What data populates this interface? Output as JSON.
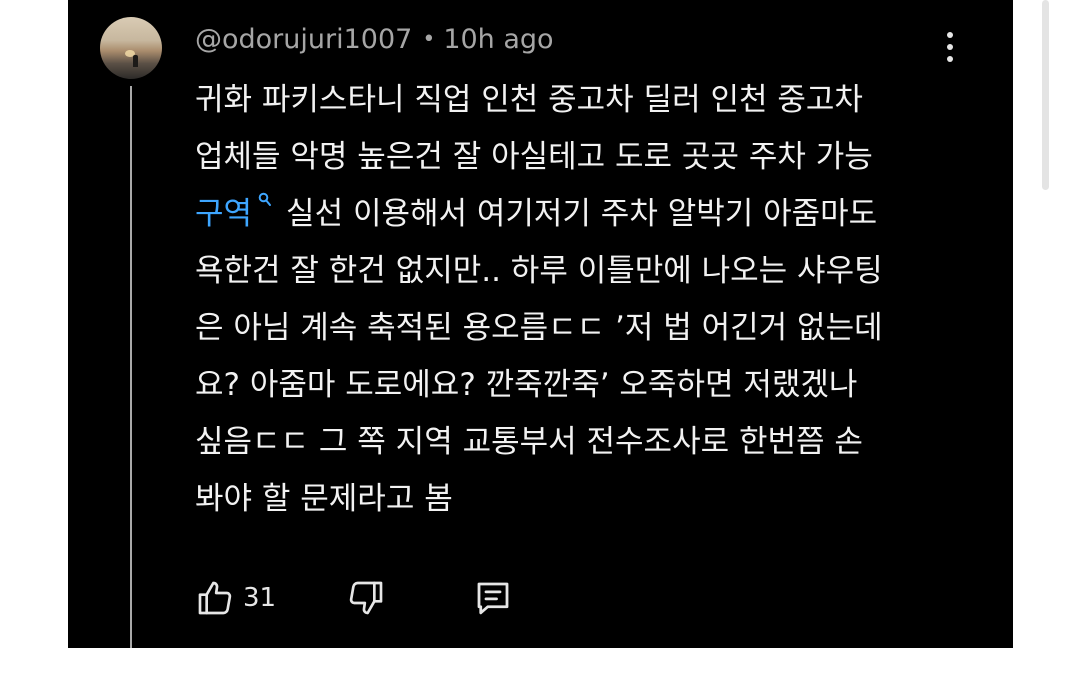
{
  "comment": {
    "username": "@odorujuri1007",
    "separator": "•",
    "timestamp": "10h ago",
    "lines": {
      "l1": "귀화 파키스타니 직업 인천 중고차 딜러 인천 중고차",
      "l2": "업체들 악명 높은건 잘 아실테고 도로 곳곳 주차 가능",
      "l3_link": "구역",
      "l3_rest": "실선 이용해서 여기저기 주차 알박기 아줌마도",
      "l4": "욕한건 잘 한건 없지만.. 하루 이틀만에 나오는 샤우팅",
      "l5": "은 아님 계속 축적된 용오름ㄷㄷ ’저 법 어긴거 없는데",
      "l6": "요? 아줌마 도로에요? 깐죽깐죽’ 오죽하면 저랬겠나",
      "l7": "싶음ㄷㄷ 그 쪽 지역 교통부서 전수조사로 한번쯤 손",
      "l8": "봐야 할 문제라고 봄"
    },
    "like_count": "31"
  },
  "icons": {
    "more": "more-vertical-icon",
    "search": "search-icon",
    "like": "thumbs-up-icon",
    "dislike": "thumbs-down-icon",
    "reply": "comment-icon"
  },
  "colors": {
    "background": "#000000",
    "text": "#f2f2f2",
    "meta": "#a6a6a6",
    "link": "#3ea6ff"
  }
}
